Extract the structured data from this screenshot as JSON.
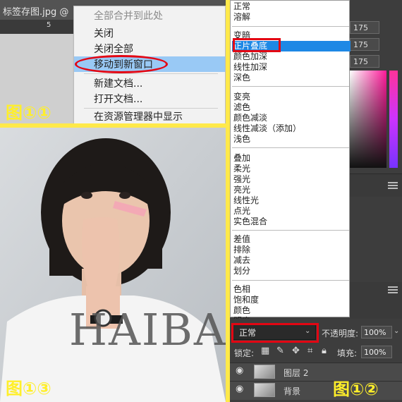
{
  "panel_tab": {
    "title": "标签存图.jpg @",
    "ruler_number": "5",
    "context_menu": [
      {
        "label": "全部合并到此处",
        "state": "disabled"
      },
      {
        "label": "关闭",
        "state": "normal"
      },
      {
        "label": "关闭全部",
        "state": "normal"
      },
      {
        "label": "移动到新窗口",
        "state": "highlighted"
      },
      {
        "label": "新建文档...",
        "state": "normal"
      },
      {
        "label": "打开文档...",
        "state": "normal"
      },
      {
        "label": "在资源管理器中显示",
        "state": "normal"
      }
    ],
    "caption": "图①①"
  },
  "panel_layers": {
    "color_values": [
      "175",
      "175",
      "175"
    ],
    "blend_groups": [
      [
        "正常",
        "溶解"
      ],
      [
        "变暗",
        "正片叠底",
        "颜色加深",
        "线性加深",
        "深色"
      ],
      [
        "变亮",
        "滤色",
        "颜色减淡",
        "线性减淡（添加）",
        "浅色"
      ],
      [
        "叠加",
        "柔光",
        "强光",
        "亮光",
        "线性光",
        "点光",
        "实色混合"
      ],
      [
        "差值",
        "排除",
        "减去",
        "划分"
      ],
      [
        "色相",
        "饱和度",
        "颜色",
        "明度"
      ]
    ],
    "selected_blend": "正片叠底",
    "current_mode": "正常",
    "opacity_label": "不透明度:",
    "opacity_value": "100%",
    "lock_label": "锁定:",
    "fill_label": "填充:",
    "fill_value": "100%",
    "layers": [
      {
        "name": "图层 2"
      },
      {
        "name": "背景"
      }
    ],
    "caption": "图①②"
  },
  "panel_photo": {
    "watermark": "HAIBA",
    "caption": "图①③"
  },
  "colors": {
    "highlight_yellow": "#ffe94a",
    "caption_yellow": "#ffef2a",
    "annotation_red": "#e30613",
    "menu_highlight": "#99c9f5",
    "blend_selected": "#1e88e5"
  }
}
